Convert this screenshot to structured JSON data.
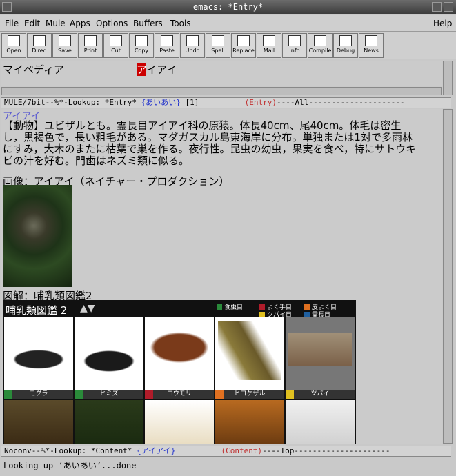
{
  "window": {
    "title": "emacs: *Entry*"
  },
  "menu": {
    "file": "File",
    "edit": "Edit",
    "mule": "Mule",
    "apps": "Apps",
    "options": "Options",
    "buffers": "Buffers",
    "tools": "Tools",
    "help": "Help"
  },
  "toolbar": [
    "Open",
    "Dired",
    "Save",
    "Print",
    "Cut",
    "Copy",
    "Paste",
    "Undo",
    "Spell",
    "Replace",
    "Mail",
    "Info",
    "Compile",
    "Debug",
    "News"
  ],
  "lookup": {
    "word1": "マイペディア",
    "word2_hl": "ア",
    "word2_rest": "イアイ"
  },
  "modeline1": {
    "a": "MULE/7bit--%*-Lookup: *Entry* ",
    "b": "{あいあい}",
    "c": " [1]          ",
    "d": "(Entry)",
    "e": "----All---------------------"
  },
  "entry": {
    "heading": "アイアイ",
    "body": "【動物】ユビザルとも。霊長目アイアイ科の原猿。体長40cm、尾40cm。体毛は密生し，黒褐色で，長い粗毛がある。マダガスカル島東海岸に分布。単独または1対で多雨林にすみ，大木のまたに枯葉で巣を作る。夜行性。昆虫の幼虫，果実を食べ，特にサトウキビの汁を好む。門歯はネズミ類に似る。",
    "image_caption": "画像：アイアイ（ネイチャー・プロダクション）",
    "figure_caption": "図解：哺乳類図鑑2"
  },
  "guide": {
    "title": "哺乳類図鑑 2",
    "arrows": "▲▼",
    "legend": [
      {
        "label": "食虫目",
        "color": "#2a8a3a"
      },
      {
        "label": "よく手目",
        "color": "#b01c2a"
      },
      {
        "label": "皮よく目",
        "color": "#e07020"
      },
      {
        "label": "ツパイ目",
        "color": "#e0c020"
      },
      {
        "label": "霊長目",
        "color": "#2060a0"
      }
    ],
    "animals": [
      {
        "name": "モグラ",
        "color": "#2a8a3a"
      },
      {
        "name": "ヒミズ",
        "color": "#2a8a3a"
      },
      {
        "name": "コウモリ",
        "color": "#b01c2a"
      },
      {
        "name": "ヒヨケザル",
        "color": "#e07020"
      },
      {
        "name": "ツパイ",
        "color": "#e0c020"
      }
    ]
  },
  "modeline2": {
    "a": "Noconv--%*-Lookup: *Content* ",
    "b": "{アイアイ}",
    "c": "          ",
    "d": "(Content)",
    "e": "----Top---------------------"
  },
  "echo": "Looking up ‘あいあい’...done"
}
